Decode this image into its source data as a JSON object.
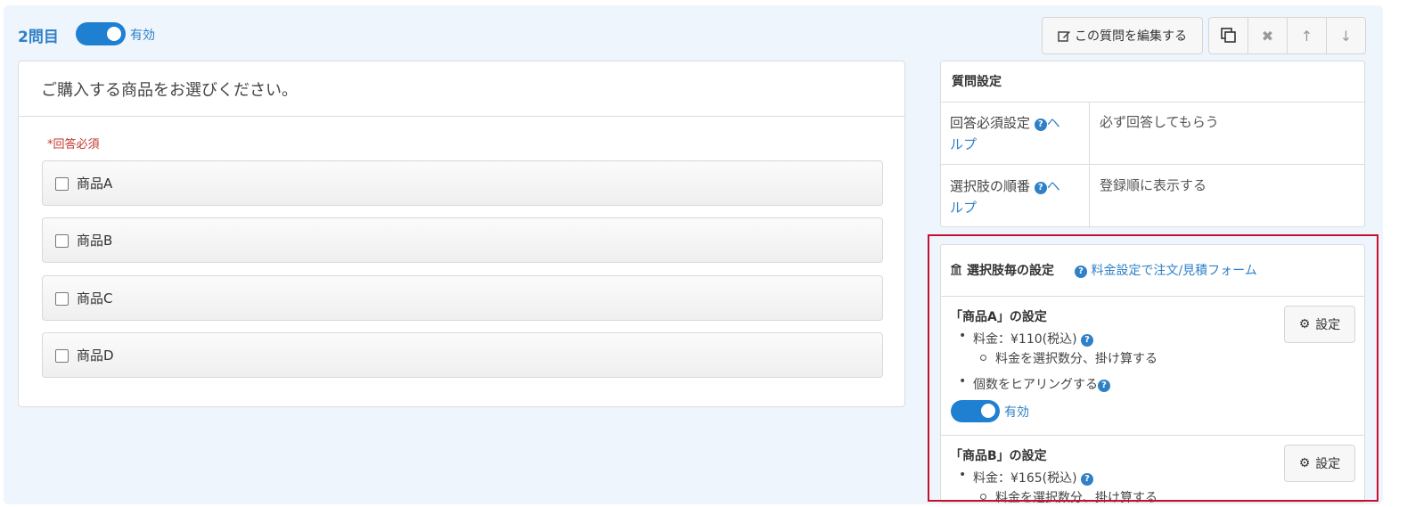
{
  "question": {
    "number_label": "2問目",
    "enabled_label": "有効",
    "title": "ご購入する商品をお選びください。",
    "required_label": "*回答必須",
    "options": [
      "商品A",
      "商品B",
      "商品C",
      "商品D"
    ]
  },
  "toolbar": {
    "edit_label": "この質問を編集する"
  },
  "settings": {
    "heading": "質問設定",
    "rows": [
      {
        "key_line1": "回答必須設定",
        "help_part1": "ヘ",
        "help_part2": "ルプ",
        "value": "必ず回答してもらう"
      },
      {
        "key_line1": "選択肢の順番",
        "help_part1": "ヘ",
        "help_part2": "ルプ",
        "value": "登録順に表示する"
      }
    ]
  },
  "choice_settings": {
    "heading": "選択肢毎の設定",
    "link": "料金設定で注文/見積フォーム",
    "button_label": "設定",
    "items": [
      {
        "title": "「商品A」の設定",
        "price": "料金：¥110(税込)",
        "sub": "料金を選択数分、掛け算する",
        "count": "個数をヒアリングする",
        "enabled_label": "有効"
      },
      {
        "title": "「商品B」の設定",
        "price": "料金：¥165(税込)",
        "sub": "料金を選択数分、掛け算する"
      }
    ]
  },
  "colors": {
    "accent": "#1f7fd1",
    "highlight_border": "#c8102e",
    "required": "#c0392b"
  }
}
